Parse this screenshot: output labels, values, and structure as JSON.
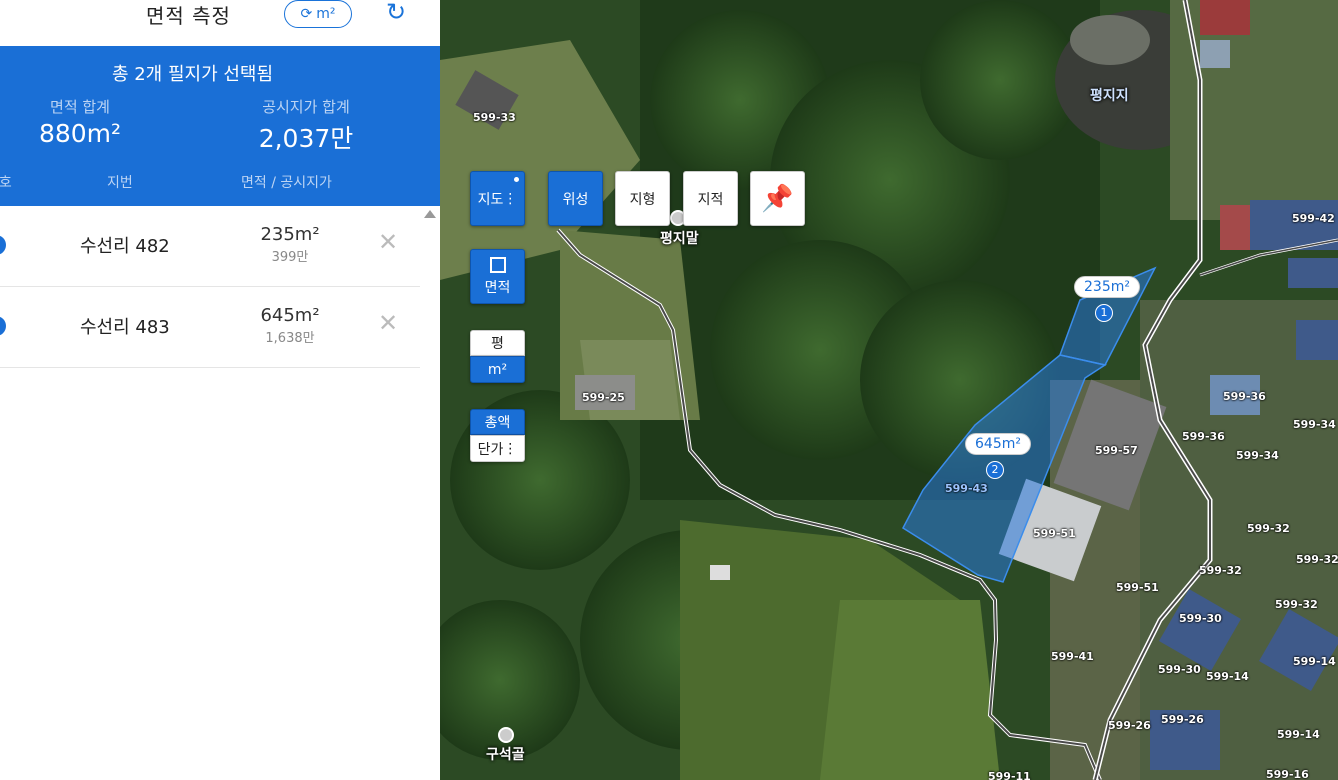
{
  "panel": {
    "title": "면적 측정",
    "unit_toggle_label": "m²",
    "summary": {
      "title": "총 2개 필지가 선택됨",
      "area_label": "면적 합계",
      "area_value": "880m²",
      "price_label": "공시지가 합계",
      "price_value": "2,037만"
    },
    "columns": [
      "번호",
      "지번",
      "면적 / 공시지가"
    ],
    "rows": [
      {
        "jibun": "수선리 482",
        "area": "235m²",
        "price": "399만"
      },
      {
        "jibun": "수선리 483",
        "area": "645m²",
        "price": "1,638만"
      }
    ]
  },
  "map": {
    "buttons": {
      "map": "지도",
      "satellite": "위성",
      "terrain": "지형",
      "cadastral": "지적",
      "area": "면적",
      "unit_pyeong": "평",
      "unit_m2": "m²",
      "total": "총액",
      "unit_price": "단가"
    },
    "places": [
      "평지말",
      "구석골",
      "평지지"
    ],
    "callouts": [
      {
        "num": "1",
        "label": "235m²"
      },
      {
        "num": "2",
        "label": "645m²"
      }
    ],
    "parcel_labels": [
      "599-33",
      "599-42",
      "599-25",
      "599-36",
      "599-36",
      "599-34",
      "599-34",
      "599-57",
      "599-43",
      "599-51",
      "599-51",
      "599-32",
      "599-32",
      "599-32",
      "599-32",
      "599-30",
      "599-30",
      "599-14",
      "599-14",
      "599-41",
      "599-26",
      "599-26",
      "599-14",
      "599-16",
      "599-11"
    ]
  },
  "colors": {
    "accent": "#1a6fd6",
    "panel_bg": "#ffffff"
  }
}
